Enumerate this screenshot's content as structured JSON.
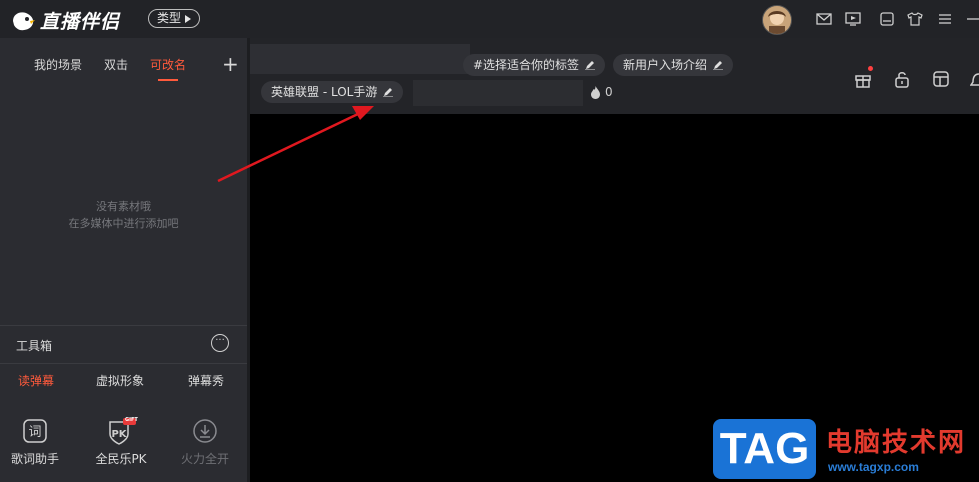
{
  "app": {
    "title": "直播伴侣",
    "type_button": "类型"
  },
  "titlebar_icons": [
    "mail-icon",
    "video-icon",
    "screen-icon",
    "shirt-icon",
    "menu-icon",
    "minimize-icon"
  ],
  "scenes": {
    "tabs": [
      {
        "label": "我的场景",
        "active": false
      },
      {
        "label": "双击",
        "active": false
      },
      {
        "label": "可改名",
        "active": true
      }
    ],
    "add": "+",
    "empty_line1": "没有素材哦",
    "empty_line2": "在多媒体中进行添加吧"
  },
  "toolbox": {
    "title": "工具箱",
    "subtabs": [
      {
        "label": "读弹幕",
        "active": true
      },
      {
        "label": "虚拟形象",
        "active": false
      },
      {
        "label": "弹幕秀",
        "active": false
      }
    ],
    "tools": [
      {
        "label": "歌词助手",
        "icon": "lyrics-icon",
        "enabled": true
      },
      {
        "label": "全民乐PK",
        "icon": "pk-icon",
        "badge": "GIFT",
        "enabled": true
      },
      {
        "label": "火力全开",
        "icon": "download-icon",
        "enabled": false
      }
    ]
  },
  "stream": {
    "tag_button": "#选择适合你的标签",
    "intro_button": "新用户入场介绍",
    "category": "英雄联盟 - LOL手游",
    "heat": "0"
  },
  "colors": {
    "accent": "#ff5a3c",
    "annotation_arrow": "#e0181f"
  },
  "watermark": {
    "tag": "TAG",
    "title": "电脑技术网",
    "url": "www.tagxp.com"
  }
}
